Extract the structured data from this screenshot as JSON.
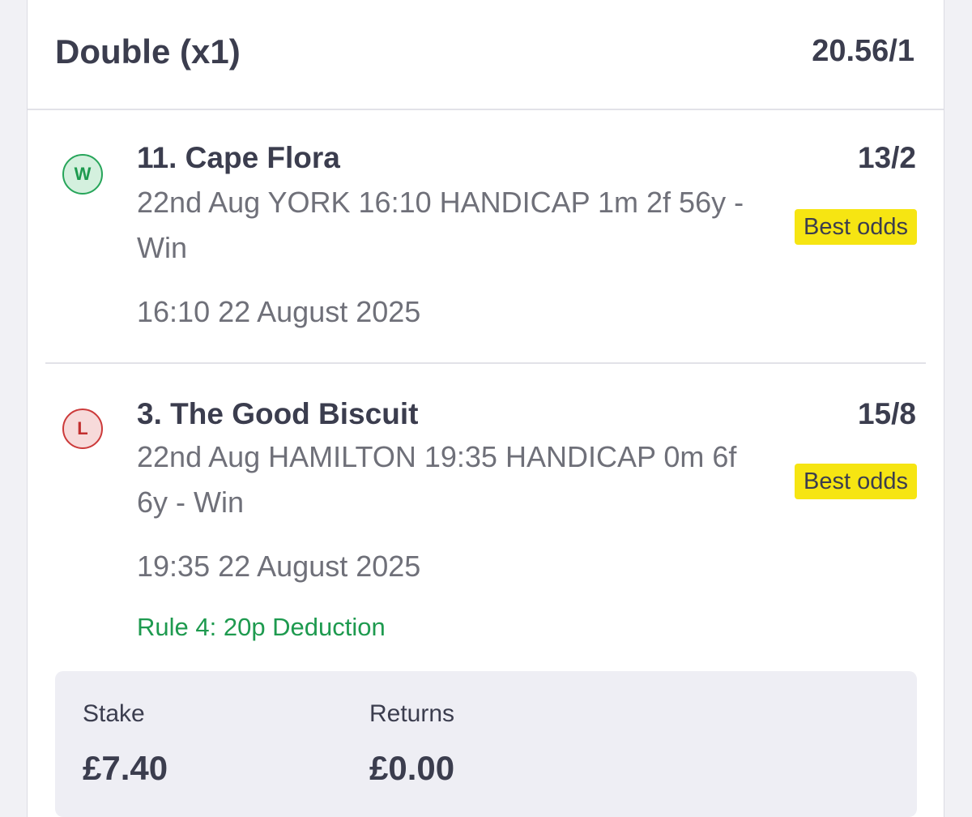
{
  "bet": {
    "type": "Double (x1)",
    "total_odds": "20.56/1"
  },
  "selections": [
    {
      "result": "W",
      "name": "11. Cape Flora",
      "odds": "13/2",
      "market": "22nd Aug YORK 16:10 HANDICAP 1m 2f 56y - Win",
      "badge": "Best odds",
      "time": "16:10 22 August 2025"
    },
    {
      "result": "L",
      "name": "3. The Good Biscuit",
      "odds": "15/8",
      "market": "22nd Aug HAMILTON 19:35 HANDICAP 0m 6f 6y - Win",
      "badge": "Best odds",
      "time": "19:35 22 August 2025",
      "deduction": "Rule 4: 20p Deduction"
    }
  ],
  "summary": {
    "stake_label": "Stake",
    "stake_value": "£7.40",
    "returns_label": "Returns",
    "returns_value": "£0.00"
  },
  "colors": {
    "win": "#27a55a",
    "lose": "#cc3a3a",
    "best_odds_bg": "#f6e512",
    "deduction_text": "#1e9a4f"
  }
}
